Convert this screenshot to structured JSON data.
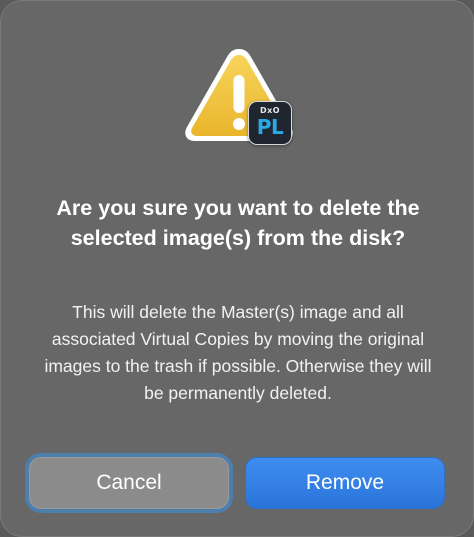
{
  "dialog": {
    "title": "Are you sure you want to delete the selected image(s) from the disk?",
    "message": "This will delete the Master(s) image and all associated Virtual Copies by moving the original images to the trash if possible. Otherwise they will be permanently deleted.",
    "icon": "warning-triangle-icon",
    "app_badge": {
      "top_text": "DxO",
      "main_text": "PL",
      "icon": "dxo-photolab-app-icon"
    },
    "buttons": {
      "cancel_label": "Cancel",
      "remove_label": "Remove"
    }
  },
  "colors": {
    "dialog_background": "#676767",
    "warning_yellow": "#f3c43c",
    "primary_button": "#2f7ee6",
    "focus_ring": "#4d7fad",
    "badge_accent": "#2aa8e8"
  }
}
